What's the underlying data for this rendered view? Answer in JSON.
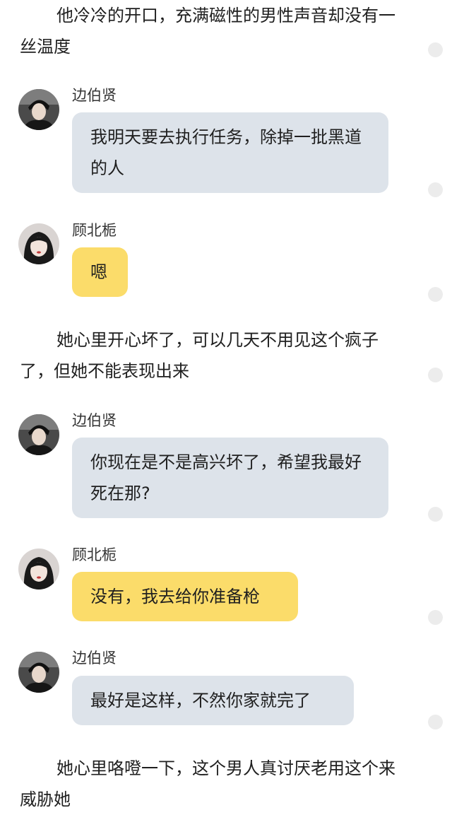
{
  "narration": [
    "他冷冷的开口，充满磁性的男性声音却没有一丝温度",
    "她心里开心坏了，可以几天不用见这个疯子了，但她不能表现出来",
    "她心里咯噔一下，这个男人真讨厌老用这个来威胁她"
  ],
  "chat": [
    {
      "speaker": "边伯贤",
      "text": "我明天要去执行任务，除掉一批黑道的人",
      "avatar": "male-avatar"
    },
    {
      "speaker": "顾北栀",
      "text": "嗯",
      "avatar": "female-avatar"
    },
    {
      "speaker": "边伯贤",
      "text": "你现在是不是高兴坏了，希望我最好死在那?",
      "avatar": "male-avatar"
    },
    {
      "speaker": "顾北栀",
      "text": "没有，我去给你准备枪",
      "avatar": "female-avatar"
    },
    {
      "speaker": "边伯贤",
      "text": "最好是这样，不然你家就完了",
      "avatar": "male-avatar"
    }
  ],
  "colors": {
    "male_bubble": "#dde3ea",
    "female_bubble": "#fbdc6a",
    "side_dot": "#ececec"
  }
}
